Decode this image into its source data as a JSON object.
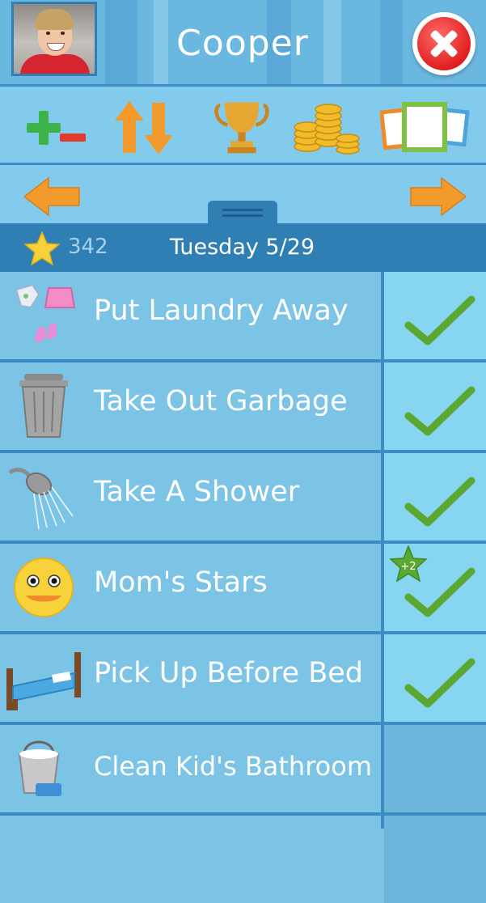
{
  "header": {
    "title": "Cooper",
    "close_icon": "close-icon",
    "avatar_icon": "child-photo"
  },
  "toolbar": {
    "items": [
      {
        "name": "plus-minus-icon"
      },
      {
        "name": "sort-arrows-icon"
      },
      {
        "name": "trophy-icon"
      },
      {
        "name": "coins-icon"
      },
      {
        "name": "picture-frames-icon"
      }
    ]
  },
  "nav": {
    "prev_icon": "arrow-left-icon",
    "next_icon": "arrow-right-icon"
  },
  "status": {
    "star_count": "342",
    "date": "Tuesday 5/29"
  },
  "chores": [
    {
      "label": "Put Laundry Away",
      "icon": "laundry-icon",
      "done": true
    },
    {
      "label": "Take Out Garbage",
      "icon": "garbage-can-icon",
      "done": true
    },
    {
      "label": "Take A Shower",
      "icon": "shower-icon",
      "done": true
    },
    {
      "label": "Mom's Stars",
      "icon": "smiley-face-icon",
      "done": true,
      "bonus": "+2"
    },
    {
      "label": "Pick Up Before Bed",
      "icon": "bed-icon",
      "done": true
    },
    {
      "label": "Clean Kid's Bathroom",
      "icon": "bucket-icon",
      "done": false
    }
  ],
  "colors": {
    "background": "#7cc4e6",
    "datebar": "#2f7fb4",
    "check": "#5aa832",
    "close": "#e11f1f"
  }
}
